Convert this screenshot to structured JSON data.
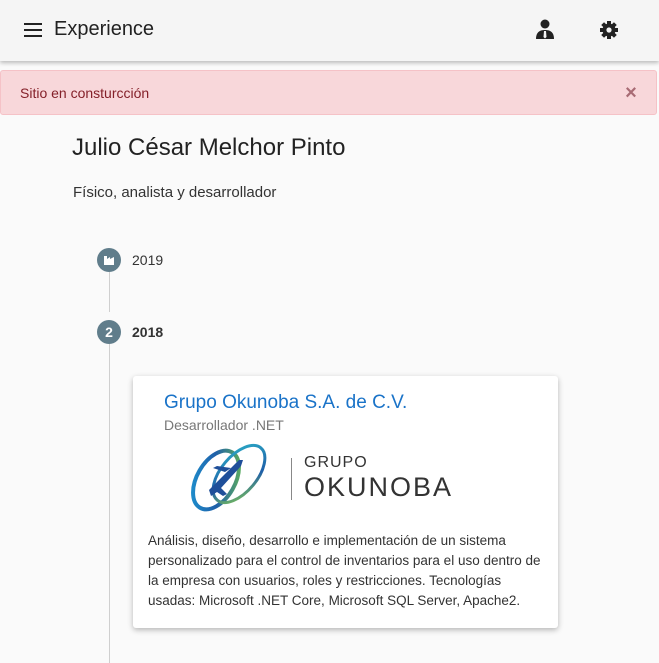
{
  "header": {
    "title": "Experience",
    "icons": [
      "menu-icon",
      "user-tie-icon",
      "gear-icon"
    ]
  },
  "alert": {
    "text": "Sitio en consturcción",
    "close_label": "×"
  },
  "profile": {
    "name": "Julio César Melchor Pinto",
    "subtitle": "Físico, analista y desarrollador"
  },
  "timeline": [
    {
      "year": "2019",
      "badge": ""
    },
    {
      "year": "2018",
      "badge": "2"
    }
  ],
  "card": {
    "company": "Grupo Okunoba S.A. de C.V.",
    "role": "Desarrollador .NET",
    "logo_line1": "GRUPO",
    "logo_line2": "OKUNOBA",
    "description": "Análisis, diseño, desarrollo e implementación de un sistema personalizado para el control de inventarios para el uso dentro de la empresa con usuarios, roles y restricciones. Tecnologías usadas: Microsoft .NET Core, Microsoft SQL Server, Apache2."
  },
  "colors": {
    "alert_bg": "#f8d7da",
    "alert_text": "#842029",
    "link": "#1a73c8",
    "timeline_dot": "#607d8b"
  }
}
